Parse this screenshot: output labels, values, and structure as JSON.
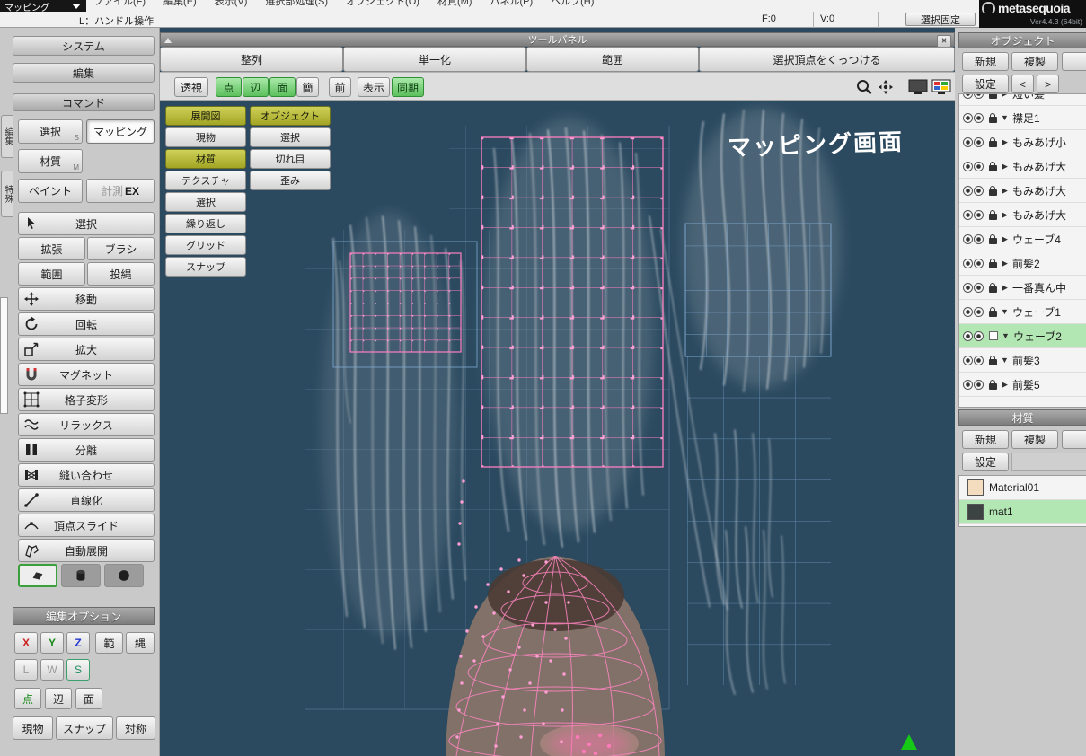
{
  "menu": {
    "items": [
      "ファイル(F)",
      "編集(E)",
      "表示(V)",
      "選択部処理(S)",
      "オブジェクト(O)",
      "材質(M)",
      "パネル(P)",
      "ヘルプ(H)"
    ]
  },
  "titlebar": {
    "mode": "マッピング",
    "status": "L：ハンドル操作",
    "face_count": "F:0",
    "vertex_count": "V:0",
    "selection_lock": "選択固定",
    "logo": "metasequoia",
    "version": "Ver4.4.3 (64bit)"
  },
  "left_panel": {
    "system": "システム",
    "edit": "編集",
    "command": "コマンド",
    "side_tabs": [
      "編集",
      "特殊"
    ],
    "modes": {
      "select": "選択",
      "select_key": "S",
      "mapping": "マッピング",
      "material": "材質",
      "material_key": "M",
      "paint": "ペイント",
      "measure": "計測",
      "measure_suffix": "EX"
    },
    "tools": [
      "選択",
      "拡張",
      "ブラシ",
      "範囲",
      "投縄",
      "移動",
      "回転",
      "拡大",
      "マグネット",
      "格子変形",
      "リラックス",
      "分離",
      "縫い合わせ",
      "直線化",
      "頂点スライド",
      "自動展開"
    ],
    "edit_options": {
      "title": "編集オプション",
      "axis_x": "X",
      "axis_y": "Y",
      "axis_z": "Z",
      "range": "範",
      "rope": "縄",
      "local": "L",
      "world": "W",
      "screen": "S",
      "point": "点",
      "edge": "辺",
      "face": "面",
      "current": "現物",
      "snap": "スナップ",
      "symmetry": "対称"
    }
  },
  "tool_panel": {
    "title": "ツールパネル",
    "close": "×",
    "actions": [
      "整列",
      "単一化",
      "範囲",
      "選択頂点をくっつける"
    ],
    "view": {
      "perspective": "透視",
      "point": "点",
      "edge": "辺",
      "face": "面",
      "simple": "簡",
      "front": "前",
      "display": "表示",
      "sync": "同期"
    },
    "stack": [
      "展開図",
      "オブジェクト",
      "現物",
      "選択",
      "材質",
      "切れ目",
      "テクスチャ",
      "歪み",
      "選択",
      "繰り返し",
      "グリッド",
      "スナップ"
    ]
  },
  "viewport": {
    "annotation": "マッピング画面"
  },
  "object_panel": {
    "title": "オブジェクト",
    "new": "新規",
    "duplicate": "複製",
    "settings": "設定",
    "prev": "<",
    "next": ">",
    "objects": [
      {
        "name": "短い髪",
        "exp": "▶"
      },
      {
        "name": "襟足1",
        "exp": "▼"
      },
      {
        "name": "もみあげ小",
        "exp": "▶"
      },
      {
        "name": "もみあげ大",
        "exp": "▶"
      },
      {
        "name": "もみあげ大",
        "exp": "▶"
      },
      {
        "name": "もみあげ大",
        "exp": "▶"
      },
      {
        "name": "ウェーブ4",
        "exp": "▶"
      },
      {
        "name": "前髪2",
        "exp": "▶"
      },
      {
        "name": "一番真ん中",
        "exp": "▶"
      },
      {
        "name": "ウェーブ1",
        "exp": "▼"
      },
      {
        "name": "ウェーブ2",
        "exp": "▼"
      },
      {
        "name": "前髪3",
        "exp": "▼"
      },
      {
        "name": "前髪5",
        "exp": "▶"
      }
    ]
  },
  "material_panel": {
    "title": "材質",
    "new": "新規",
    "duplicate": "複製",
    "settings": "設定",
    "materials": [
      {
        "name": "Material01",
        "color": "#f4dcbe"
      },
      {
        "name": "mat1",
        "color": "#3d4242"
      }
    ]
  },
  "colors": {
    "viewport_bg": "#2b4a60",
    "selection_pink": "#ff7fc0",
    "selected_row_green": "#b2e6b2",
    "toggle_green": "#7ed87e",
    "toggle_olive": "#b9bd3f"
  }
}
